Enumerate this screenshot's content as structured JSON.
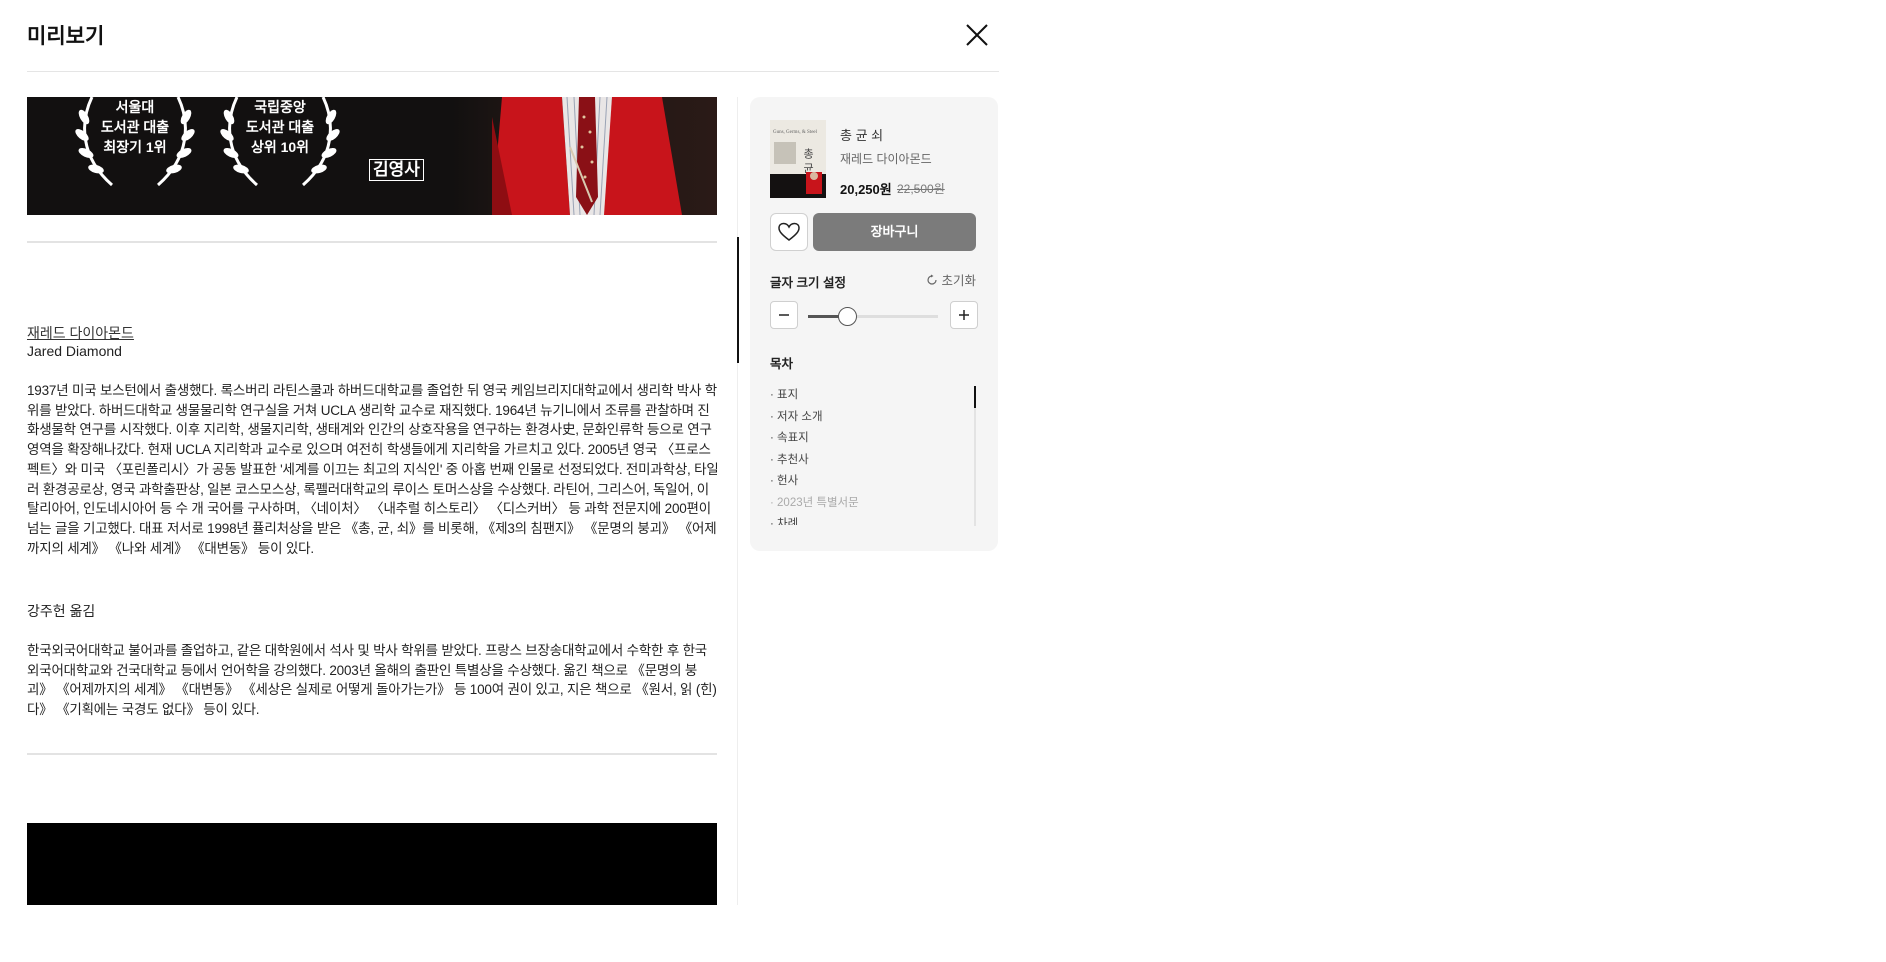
{
  "header": {
    "title": "미리보기"
  },
  "banner": {
    "award1_lines": [
      "서울대",
      "도서관 대출",
      "최장기 1위"
    ],
    "award2_lines": [
      "국립중앙",
      "도서관 대출",
      "상위 10위"
    ],
    "publisher": "김영사"
  },
  "content": {
    "author_name": "재레드 다이아몬드",
    "author_name_en": "Jared Diamond",
    "author_bio": "1937년 미국 보스턴에서 출생했다. 록스버리 라틴스쿨과 하버드대학교를 졸업한 뒤 영국 케임브리지대학교에서 생리학 박사 학위를 받았다. 하버드대학교 생물물리학 연구실을 거쳐 UCLA 생리학 교수로 재직했다. 1964년 뉴기니에서 조류를 관찰하며 진화생물학 연구를 시작했다. 이후 지리학, 생물지리학, 생태계와 인간의 상호작용을 연구하는 환경사史, 문화인류학 등으로 연구 영역을 확장해나갔다. 현재 UCLA 지리학과 교수로 있으며 여전히 학생들에게 지리학을 가르치고 있다. 2005년 영국 〈프로스펙트〉와 미국 〈포린폴리시〉가 공동 발표한 '세계를 이끄는 최고의 지식인' 중 아홉 번째 인물로 선정되었다. 전미과학상, 타일러 환경공로상, 영국 과학출판상, 일본 코스모스상, 록펠러대학교의 루이스 토머스상을 수상했다. 라틴어, 그리스어, 독일어, 이탈리아어, 인도네시아어 등 수 개 국어를 구사하며, 〈네이처〉 〈내추럴 히스토리〉 〈디스커버〉 등 과학 전문지에 200편이 넘는 글을 기고했다. 대표 저서로 1998년 퓰리처상을 받은 《총, 균, 쇠》를 비롯해, 《제3의 침팬지》 《문명의 붕괴》 《어제까지의 세계》 《나와 세계》 《대변동》 등이 있다.",
    "translator": "강주헌 옮김",
    "translator_bio": "한국외국어대학교 불어과를 졸업하고, 같은 대학원에서 석사 및 박사 학위를 받았다. 프랑스 브장송대학교에서 수학한 후 한국외국어대학교와 건국대학교 등에서 언어학을 강의했다. 2003년 올해의 출판인 특별상을 수상했다. 옮긴 책으로 《문명의 붕괴》 《어제까지의 세계》 《대변동》 《세상은 실제로 어떻게 돌아가는가》 등 100여 권이 있고, 지은 책으로 《원서, 읽 (힌)다》 《기획에는 국경도 없다》 등이 있다."
  },
  "book": {
    "cover_title": "총 균 쇠",
    "cover_subtitle": "Guns, Germs, & Steel",
    "title": "총 균 쇠",
    "author": "재레드 다이아몬드",
    "price": "20,250원",
    "original_price": "22,500원",
    "cart_label": "장바구니"
  },
  "font_settings": {
    "label": "글자 크기 설정",
    "reset_label": "초기화",
    "level": 0.3
  },
  "toc": {
    "label": "목차",
    "items": [
      {
        "label": "· 표지",
        "dim": false
      },
      {
        "label": "· 저자 소개",
        "dim": false
      },
      {
        "label": "· 속표지",
        "dim": false
      },
      {
        "label": "· 추천사",
        "dim": false
      },
      {
        "label": "· 헌사",
        "dim": false
      },
      {
        "label": "· 2023년 특별서문",
        "dim": true
      },
      {
        "label": "· 차례",
        "dim": false
      }
    ]
  },
  "colors": {
    "cart_bg": "#7b7b7b",
    "panel_bg": "#f5f5f5",
    "banner_bg": "#121010",
    "jacket_red": "#c8141b"
  }
}
